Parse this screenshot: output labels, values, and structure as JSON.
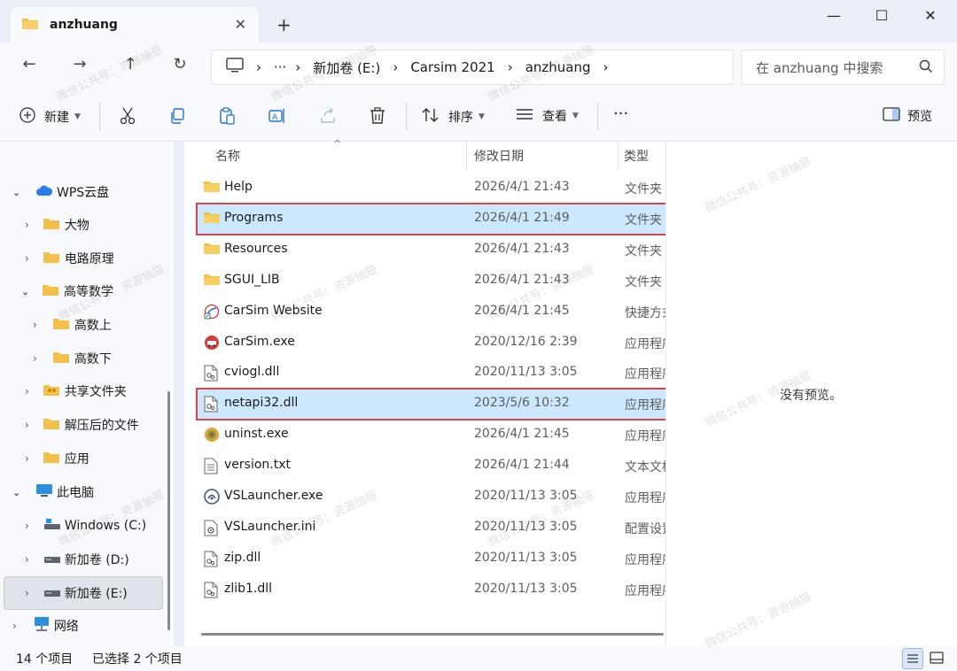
{
  "window": {
    "tab_title": "anzhuang",
    "new_tab": "+",
    "minimize": "—",
    "maximize": "☐",
    "close": "✕"
  },
  "address": {
    "crumbs": [
      "新加卷 (E:)",
      "Carsim 2021",
      "anzhuang"
    ],
    "more": "···",
    "search_placeholder": "在 anzhuang 中搜索"
  },
  "toolbar": {
    "new_label": "新建",
    "sort_label": "排序",
    "view_label": "查看",
    "more_label": "···",
    "preview_label": "预览"
  },
  "nav": {
    "items": [
      {
        "label": "WPS云盘",
        "icon": "cloud-icon"
      },
      {
        "label": "大物",
        "icon": "folder-icon"
      },
      {
        "label": "电路原理",
        "icon": "folder-icon"
      },
      {
        "label": "高等数学",
        "icon": "folder-icon"
      },
      {
        "label": "高数上",
        "icon": "folder-icon"
      },
      {
        "label": "高数下",
        "icon": "folder-icon"
      },
      {
        "label": "共享文件夹",
        "icon": "shared-folder-icon"
      },
      {
        "label": "解压后的文件",
        "icon": "folder-icon"
      },
      {
        "label": "应用",
        "icon": "folder-icon"
      },
      {
        "label": "此电脑",
        "icon": "pc-icon"
      },
      {
        "label": "Windows (C:)",
        "icon": "drive-icon"
      },
      {
        "label": "新加卷 (D:)",
        "icon": "drive-icon"
      },
      {
        "label": "新加卷 (E:)",
        "icon": "drive-icon"
      },
      {
        "label": "网络",
        "icon": "network-icon"
      }
    ]
  },
  "columns": {
    "name": "名称",
    "date": "修改日期",
    "type": "类型"
  },
  "files": [
    {
      "name": "Help",
      "date": "2026/4/1 21:43",
      "type": "文件夹",
      "icon": "folder-icon"
    },
    {
      "name": "Programs",
      "date": "2026/4/1 21:49",
      "type": "文件夹",
      "icon": "folder-icon"
    },
    {
      "name": "Resources",
      "date": "2026/4/1 21:43",
      "type": "文件夹",
      "icon": "folder-icon"
    },
    {
      "name": "SGUI_LIB",
      "date": "2026/4/1 21:43",
      "type": "文件夹",
      "icon": "folder-icon"
    },
    {
      "name": "CarSim Website",
      "date": "2026/4/1 21:45",
      "type": "快捷方式",
      "icon": "shortcut-icon"
    },
    {
      "name": "CarSim.exe",
      "date": "2020/12/16 2:39",
      "type": "应用程序",
      "icon": "app-icon"
    },
    {
      "name": "cviogl.dll",
      "date": "2020/11/13 3:05",
      "type": "应用程序扩展",
      "icon": "dll-icon"
    },
    {
      "name": "netapi32.dll",
      "date": "2023/5/6 10:32",
      "type": "应用程序扩展",
      "icon": "dll-icon"
    },
    {
      "name": "uninst.exe",
      "date": "2026/4/1 21:45",
      "type": "应用程序",
      "icon": "installer-icon"
    },
    {
      "name": "version.txt",
      "date": "2026/4/1 21:44",
      "type": "文本文档",
      "icon": "text-file-icon"
    },
    {
      "name": "VSLauncher.exe",
      "date": "2020/11/13 3:05",
      "type": "应用程序",
      "icon": "launcher-icon"
    },
    {
      "name": "VSLauncher.ini",
      "date": "2020/11/13 3:05",
      "type": "配置设置",
      "icon": "ini-file-icon"
    },
    {
      "name": "zip.dll",
      "date": "2020/11/13 3:05",
      "type": "应用程序扩展",
      "icon": "dll-icon"
    },
    {
      "name": "zlib1.dll",
      "date": "2020/11/13 3:05",
      "type": "应用程序扩展",
      "icon": "dll-icon"
    }
  ],
  "selected_rows": [
    1,
    7
  ],
  "preview": {
    "empty_text": "没有预览。"
  },
  "status": {
    "count": "14 个项目",
    "selected": "已选择 2 个项目"
  },
  "watermark": "微信公共号：资源抽屉",
  "colors": {
    "selection": "#cce8ff",
    "highlight_border": "#d9434a",
    "folder": "#f5c04a"
  }
}
